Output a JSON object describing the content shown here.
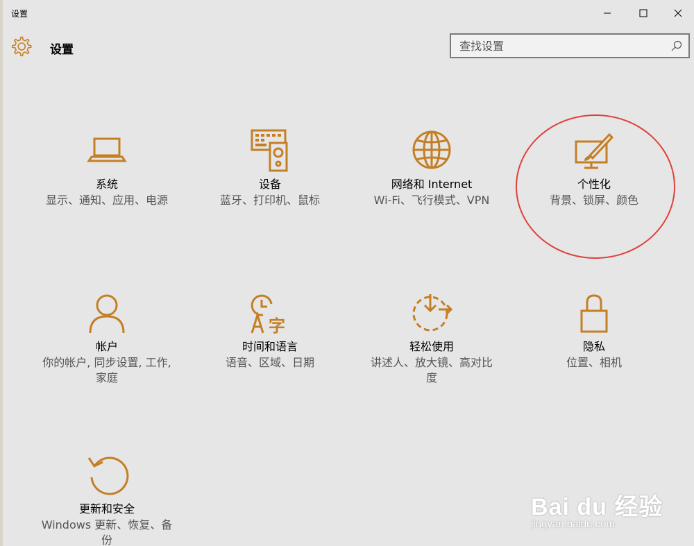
{
  "window": {
    "title": "设置",
    "controls": {
      "minimize": "minimize-icon",
      "maximize": "maximize-icon",
      "close": "close-icon"
    }
  },
  "header": {
    "title": "设置",
    "icon": "gear-icon",
    "search": {
      "placeholder": "查找设置",
      "icon": "search-icon"
    }
  },
  "accent_color": "#c47f25",
  "tiles": [
    {
      "id": "system",
      "icon": "laptop-icon",
      "name": "系统",
      "desc": "显示、通知、应用、电源"
    },
    {
      "id": "devices",
      "icon": "keyboard-speaker-icon",
      "name": "设备",
      "desc": "蓝牙、打印机、鼠标"
    },
    {
      "id": "network",
      "icon": "globe-icon",
      "name": "网络和 Internet",
      "desc": "Wi-Fi、飞行模式、VPN"
    },
    {
      "id": "personalization",
      "icon": "paintbrush-monitor-icon",
      "name": "个性化",
      "desc": "背景、锁屏、颜色"
    },
    {
      "id": "accounts",
      "icon": "person-icon",
      "name": "帐户",
      "desc": "你的帐户, 同步设置, 工作, 家庭"
    },
    {
      "id": "time-language",
      "icon": "clock-language-icon",
      "name": "时间和语言",
      "desc": "语音、区域、日期"
    },
    {
      "id": "ease-of-access",
      "icon": "ease-of-access-icon",
      "name": "轻松使用",
      "desc": "讲述人、放大镜、高对比度"
    },
    {
      "id": "privacy",
      "icon": "lock-icon",
      "name": "隐私",
      "desc": "位置、相机"
    },
    {
      "id": "update-security",
      "icon": "refresh-icon",
      "name": "更新和安全",
      "desc": "Windows 更新、恢复、备份"
    }
  ],
  "annotation": {
    "highlight_color": "#e0403a"
  },
  "watermark": {
    "main": "Bai du 经验",
    "sub": "jingyan.baidu.com"
  }
}
